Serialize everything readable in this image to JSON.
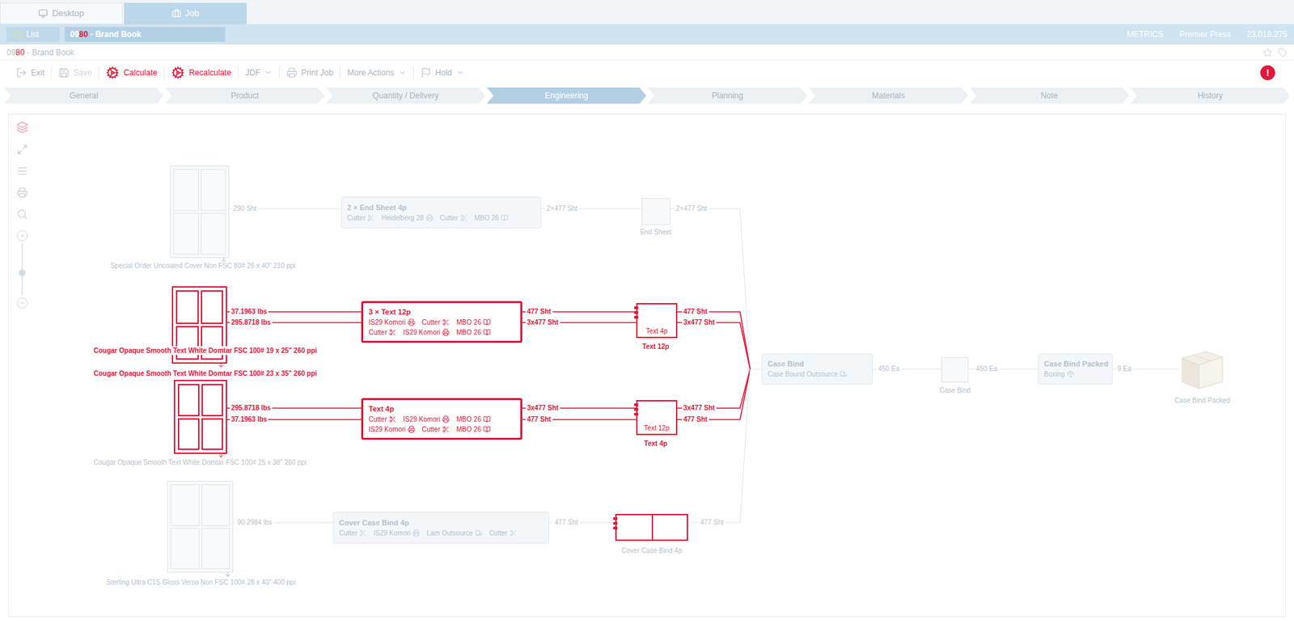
{
  "app_tabs": [
    {
      "label": "Desktop",
      "selected": false
    },
    {
      "label": "Job",
      "selected": true
    }
  ],
  "job_bar": {
    "list_button": "List",
    "job_number": {
      "plain": "09",
      "changed": "80"
    },
    "job_name": " - Brand Book",
    "info": [
      "METRICS",
      "Premier Press",
      "23.018.275"
    ]
  },
  "title_line": {
    "job_number": {
      "plain": "09",
      "changed": "80"
    },
    "job_name": " - Brand Book"
  },
  "toolbar": [
    {
      "label": "Exit",
      "changed": false,
      "dropdown": false,
      "disabled": false
    },
    {
      "label": "Save",
      "changed": false,
      "dropdown": false,
      "disabled": true
    },
    {
      "label": "Calculate",
      "changed": true,
      "dropdown": false,
      "disabled": false
    },
    {
      "label": "Recalculate",
      "changed": true,
      "dropdown": false,
      "disabled": false
    },
    {
      "label": "JDF",
      "changed": false,
      "dropdown": true,
      "disabled": false
    },
    {
      "label": "Print Job",
      "changed": false,
      "dropdown": false,
      "disabled": false
    },
    {
      "label": "More Actions",
      "changed": false,
      "dropdown": true,
      "disabled": false
    },
    {
      "label": "Hold",
      "changed": false,
      "dropdown": true,
      "disabled": false
    }
  ],
  "alert": "!",
  "steps": [
    {
      "label": "General",
      "selected": false
    },
    {
      "label": "Product",
      "selected": false
    },
    {
      "label": "Quantity / Delivery",
      "selected": false
    },
    {
      "label": "Engineering",
      "selected": true
    },
    {
      "label": "Planning",
      "selected": false
    },
    {
      "label": "Materials",
      "selected": false
    },
    {
      "label": "Note",
      "selected": false
    },
    {
      "label": "History",
      "selected": false
    }
  ],
  "canvas_tools": {
    "zoom_level": 0.43
  },
  "diagram": {
    "rows": [
      {
        "changed": false,
        "material": {
          "labels": [
            {
              "text": "Special Order Uncoated Cover Non FSC 80# 26 x 40\" 210 ppi",
              "changed": false
            }
          ]
        },
        "material_out": [
          "290 Sht"
        ],
        "process": {
          "title": "2 × End Sheet 4p",
          "steps": [
            [
              {
                "label": "Cutter",
                "kind": "cut"
              },
              {
                "label": "Heidelberg 28",
                "kind": "press"
              },
              {
                "label": "Cutter",
                "kind": "cut"
              },
              {
                "label": "MBO 26",
                "kind": "fold"
              }
            ]
          ]
        },
        "process_out": [
          "2×477 Sht"
        ],
        "product": {
          "label": "End Sheet",
          "changed": false
        },
        "product_out": [
          "2×477 Sht"
        ]
      },
      {
        "changed": true,
        "material": {
          "labels": [
            {
              "text": "Cougar Opaque Smooth Text White Domtar FSC 100# 19 x 25\" 260 ppi",
              "changed": true
            }
          ]
        },
        "material_out": [
          "37.1963 lbs",
          "295.8718 lbs"
        ],
        "process": {
          "title": "3 × Text 12p",
          "steps": [
            [
              {
                "label": "IS29 Komori",
                "kind": "press"
              },
              {
                "label": "Cutter",
                "kind": "cut"
              },
              {
                "label": "MBO 26",
                "kind": "fold"
              }
            ],
            [
              {
                "label": "Cutter",
                "kind": "cut"
              },
              {
                "label": "IS29 Komori",
                "kind": "press"
              },
              {
                "label": "MBO 26",
                "kind": "fold"
              }
            ]
          ]
        },
        "process_out": [
          "477 Sht",
          "3x477 Sht"
        ],
        "product": {
          "label": "Text 12p",
          "inner": "Text 4p",
          "changed": true
        },
        "product_out": [
          "477 Sht",
          "3x477 Sht"
        ]
      },
      {
        "changed": true,
        "material": {
          "labels": [
            {
              "text": "Cougar Opaque Smooth Text White Domtar FSC 100# 23 x 35\" 260 ppi",
              "changed": true
            },
            {
              "text": "Cougar Opaque Smooth Text White Domtar FSC 100# 25 x 38\" 260 ppi",
              "changed": false
            }
          ]
        },
        "material_out": [
          "295.8718 lbs",
          "37.1963 lbs"
        ],
        "process": {
          "title": "Text 4p",
          "steps": [
            [
              {
                "label": "Cutter",
                "kind": "cut"
              },
              {
                "label": "IS29 Komori",
                "kind": "press"
              },
              {
                "label": "MBO 26",
                "kind": "fold"
              }
            ],
            [
              {
                "label": "IS29 Komori",
                "kind": "press"
              },
              {
                "label": "Cutter",
                "kind": "cut"
              },
              {
                "label": "MBO 26",
                "kind": "fold"
              }
            ]
          ]
        },
        "process_out": [
          "3x477 Sht",
          "477 Sht"
        ],
        "product": {
          "label": "Text 4p",
          "inner": "Text 12p",
          "changed": true
        },
        "product_out": [
          "3x477 Sht",
          "477 Sht"
        ]
      },
      {
        "changed": false,
        "material": {
          "labels": [
            {
              "text": "Sterling Ultra C1S Gloss Verso Non FSC 100# 28 x 40\" 400 ppi",
              "changed": false
            }
          ]
        },
        "material_out": [
          "90.2984 lbs"
        ],
        "process": {
          "title": "Cover Case Bind 4p",
          "steps": [
            [
              {
                "label": "Cutter",
                "kind": "cut"
              },
              {
                "label": "IS29 Komori",
                "kind": "press"
              },
              {
                "label": "Lam Outsource",
                "kind": "outsource"
              },
              {
                "label": "Cutter",
                "kind": "cut"
              }
            ]
          ]
        },
        "process_out": [
          "477 Sht"
        ],
        "product": {
          "label": "Cover Case Bind 4p",
          "changed": true
        },
        "product_out": [
          "477 Sht"
        ]
      }
    ],
    "assembly": [
      {
        "kind": "process",
        "title": "Case Bind",
        "steps": [
          {
            "label": "Case Bound Outsource",
            "kind": "outsource"
          }
        ]
      },
      {
        "kind": "qty",
        "label": "450 Ea"
      },
      {
        "kind": "product",
        "label": "Case Bind"
      },
      {
        "kind": "qty",
        "label": "450 Ea"
      },
      {
        "kind": "process",
        "title": "Case Bind Packed",
        "steps": [
          {
            "label": "Boxing",
            "kind": "box"
          }
        ]
      },
      {
        "kind": "qty",
        "label": "9 Ea"
      },
      {
        "kind": "package",
        "label": "Case Bind Packed"
      }
    ]
  }
}
